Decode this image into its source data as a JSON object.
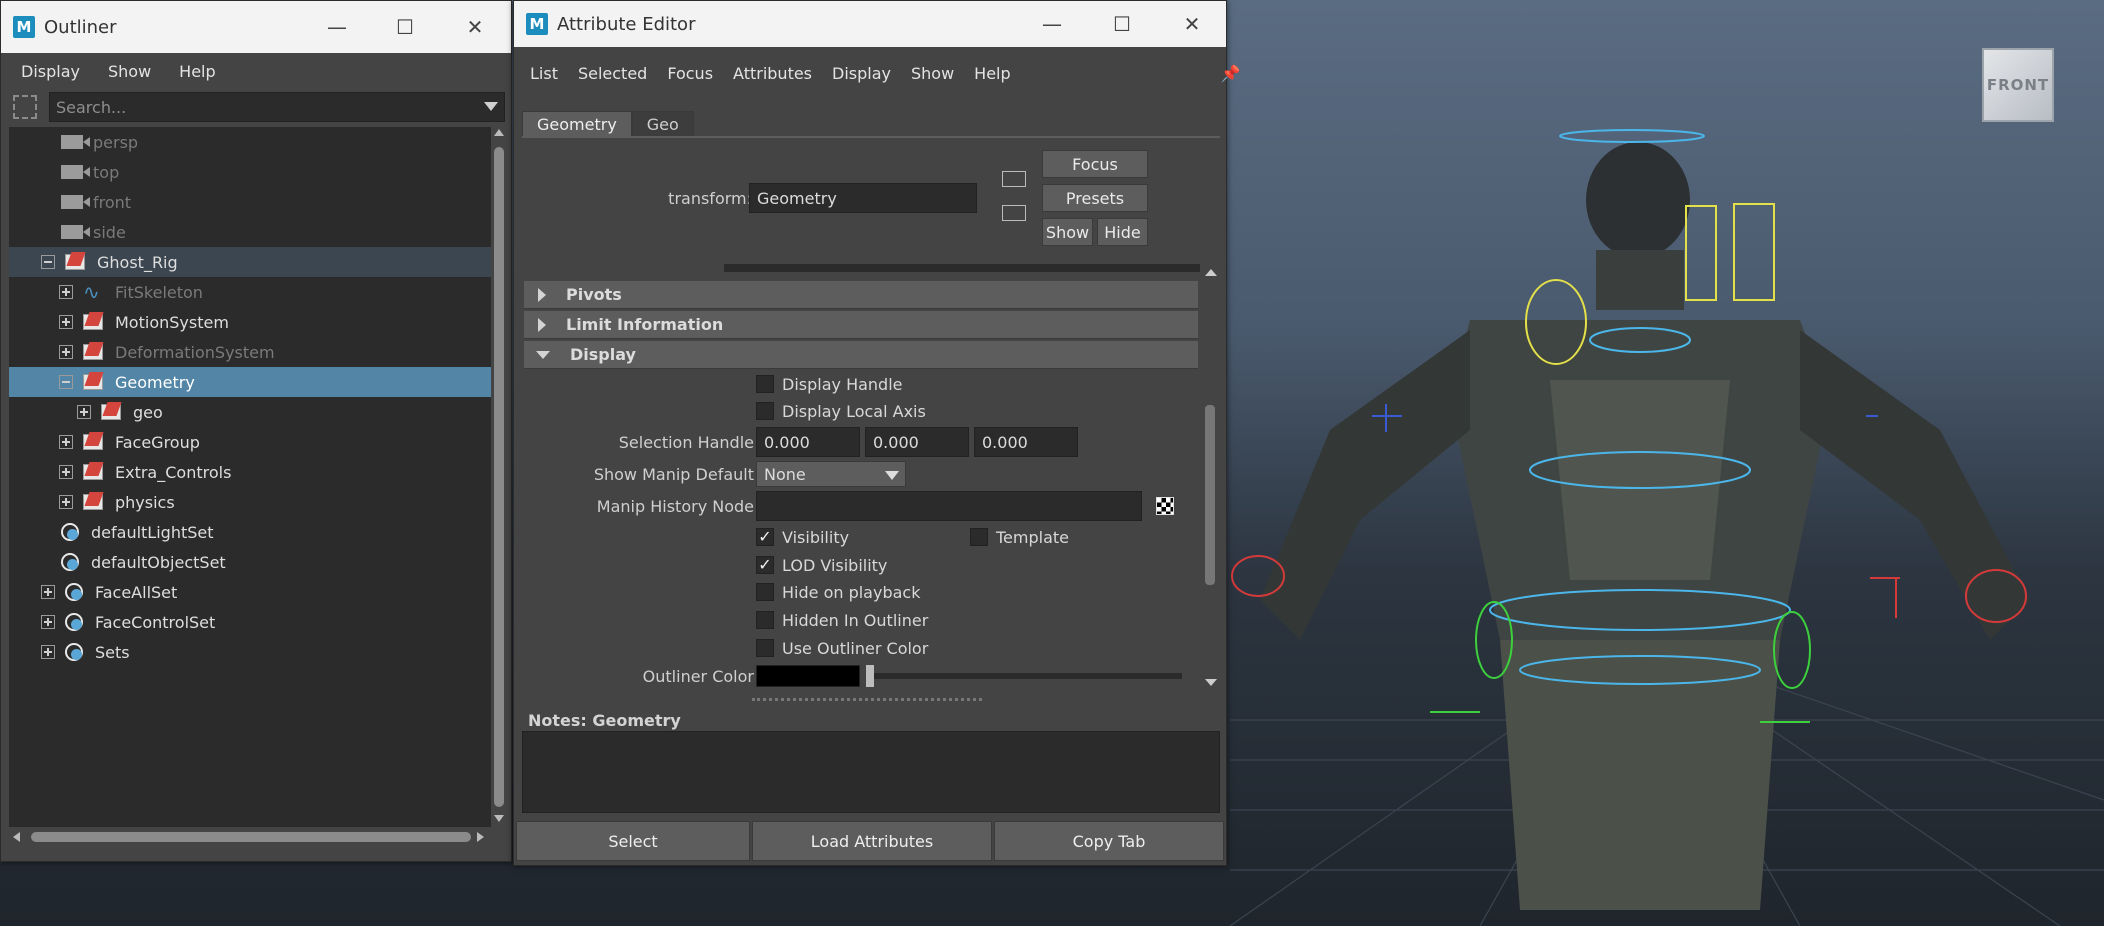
{
  "viewport": {
    "view_cube_label": "FRONT",
    "background_top": "#5a6c82",
    "background_bottom": "#1f252c"
  },
  "outliner": {
    "title": "Outliner",
    "app_icon": "M",
    "menu": [
      "Display",
      "Show",
      "Help"
    ],
    "search_placeholder": "Search...",
    "items": [
      {
        "label": "persp",
        "icon": "camera-icon"
      },
      {
        "label": "top",
        "icon": "camera-icon"
      },
      {
        "label": "front",
        "icon": "camera-icon"
      },
      {
        "label": "side",
        "icon": "camera-icon"
      },
      {
        "label": "Ghost_Rig",
        "icon": "group-icon"
      },
      {
        "label": "FitSkeleton",
        "icon": "skeleton-icon"
      },
      {
        "label": "MotionSystem",
        "icon": "group-icon"
      },
      {
        "label": "DeformationSystem",
        "icon": "group-icon"
      },
      {
        "label": "Geometry",
        "icon": "group-icon"
      },
      {
        "label": "geo",
        "icon": "group-icon"
      },
      {
        "label": "FaceGroup",
        "icon": "group-icon"
      },
      {
        "label": "Extra_Controls",
        "icon": "group-icon"
      },
      {
        "label": "physics",
        "icon": "group-icon"
      },
      {
        "label": "defaultLightSet",
        "icon": "set-icon"
      },
      {
        "label": "defaultObjectSet",
        "icon": "set-icon"
      },
      {
        "label": "FaceAllSet",
        "icon": "set-icon"
      },
      {
        "label": "FaceControlSet",
        "icon": "set-icon"
      },
      {
        "label": "Sets",
        "icon": "set-icon"
      }
    ]
  },
  "attr": {
    "title": "Attribute Editor",
    "app_icon": "M",
    "menu": [
      "List",
      "Selected",
      "Focus",
      "Attributes",
      "Display",
      "Show",
      "Help"
    ],
    "tabs": [
      "Geometry",
      "Geo"
    ],
    "transform_label": "transform:",
    "transform_value": "Geometry",
    "buttons": {
      "focus": "Focus",
      "presets": "Presets",
      "show": "Show",
      "hide": "Hide"
    },
    "sections": [
      "Pivots",
      "Limit Information",
      "Display"
    ],
    "display": {
      "display_handle": "Display Handle",
      "display_local_axis": "Display Local Axis",
      "selection_handle_label": "Selection Handle",
      "selection_handle_values": [
        "0.000",
        "0.000",
        "0.000"
      ],
      "show_manip_label": "Show Manip Default",
      "show_manip_value": "None",
      "manip_history_label": "Manip History Node",
      "visibility": "Visibility",
      "visibility_checked": true,
      "template": "Template",
      "lod_visibility": "LOD Visibility",
      "lod_checked": true,
      "hide_on_playback": "Hide on playback",
      "hidden_in_outliner": "Hidden In Outliner",
      "use_outliner_color": "Use Outliner Color",
      "outliner_color_label": "Outliner Color"
    },
    "notes_label": "Notes:  Geometry",
    "bottom": {
      "select": "Select",
      "load": "Load Attributes",
      "copy": "Copy Tab"
    }
  }
}
